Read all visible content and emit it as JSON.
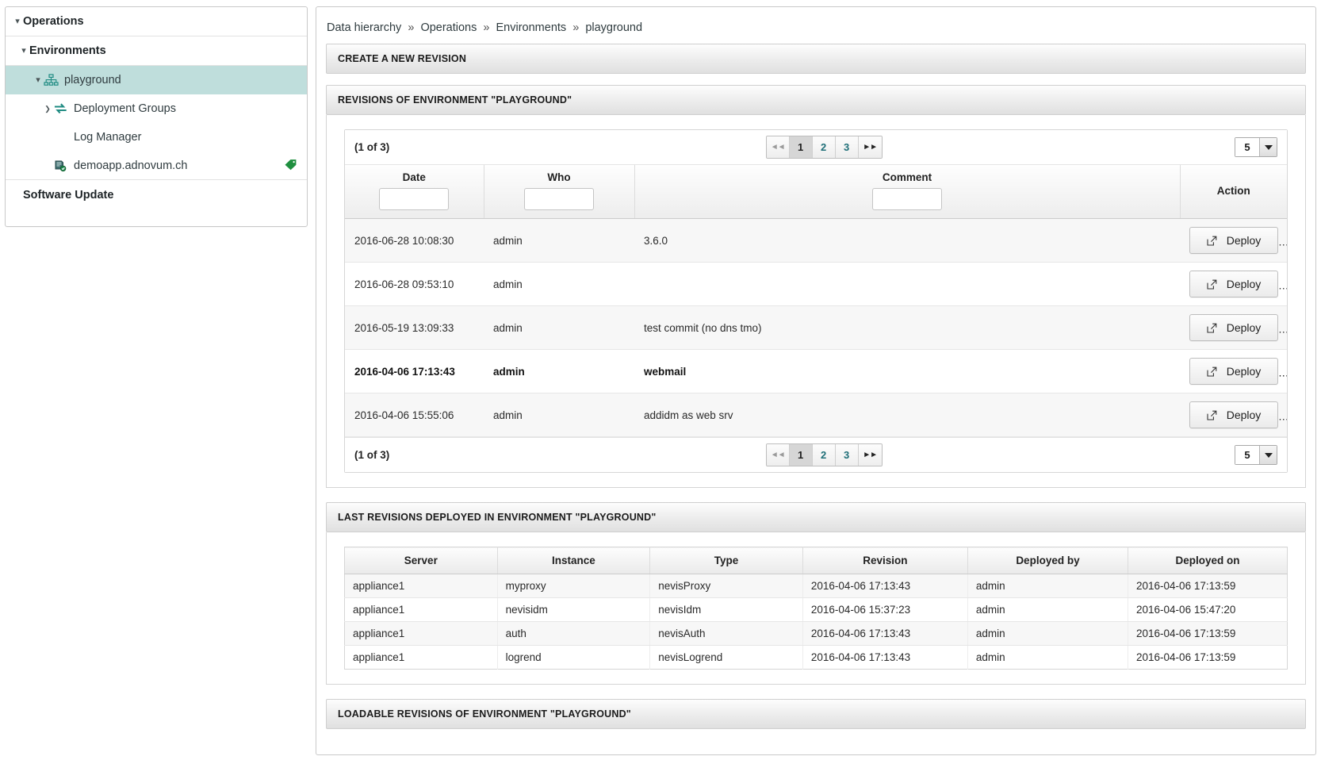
{
  "sidebar": {
    "items": [
      {
        "label": "Operations",
        "caret": "down",
        "icon": null,
        "level": 0,
        "bold": true,
        "selected": false
      },
      {
        "label": "Environments",
        "caret": "down",
        "icon": null,
        "level": 1,
        "bold": true,
        "selected": false
      },
      {
        "label": "playground",
        "caret": "down",
        "icon": "sitemap-icon",
        "level": 2,
        "bold": false,
        "selected": true
      },
      {
        "label": "Deployment Groups",
        "caret": "right",
        "icon": "sync-icon",
        "level": 3,
        "bold": false,
        "selected": false
      },
      {
        "label": "Log Manager",
        "caret": "empty",
        "icon": null,
        "level": 3,
        "bold": false,
        "selected": false
      },
      {
        "label": "demoapp.adnovum.ch",
        "caret": "empty",
        "icon": "server-icon",
        "level": 3,
        "bold": false,
        "selected": false,
        "trailing_icon": "tag-icon"
      },
      {
        "label": "Software Update",
        "caret": "empty",
        "icon": null,
        "level": 0,
        "bold": true,
        "selected": false
      }
    ]
  },
  "breadcrumb": {
    "items": [
      "Data hierarchy",
      "Operations",
      "Environments",
      "playground"
    ],
    "separator": "»"
  },
  "panels": {
    "create_revision_title": "CREATE A NEW REVISION",
    "revisions_title": "REVISIONS OF ENVIRONMENT \"PLAYGROUND\"",
    "last_deployed_title": "LAST REVISIONS DEPLOYED IN ENVIRONMENT \"PLAYGROUND\"",
    "loadable_title": "LOADABLE REVISIONS OF ENVIRONMENT \"PLAYGROUND\""
  },
  "revisions_table": {
    "pager": {
      "count_label": "(1 of 3)",
      "first_label": "◄◄",
      "last_label": "►►",
      "pages": [
        "1",
        "2",
        "3"
      ],
      "active_page": "1",
      "rows_per_page": "5"
    },
    "columns": [
      "Date",
      "Who",
      "Comment",
      "Action"
    ],
    "filters": {
      "date": "",
      "who": "",
      "comment": ""
    },
    "filter_placeholder": "",
    "action_label": "Deploy",
    "rows": [
      {
        "date": "2016-06-28 10:08:30",
        "who": "admin",
        "comment": "3.6.0",
        "bold": false
      },
      {
        "date": "2016-06-28 09:53:10",
        "who": "admin",
        "comment": "",
        "bold": false
      },
      {
        "date": "2016-05-19 13:09:33",
        "who": "admin",
        "comment": "test commit (no dns tmo)",
        "bold": false
      },
      {
        "date": "2016-04-06 17:13:43",
        "who": "admin",
        "comment": "webmail",
        "bold": true
      },
      {
        "date": "2016-04-06 15:55:06",
        "who": "admin",
        "comment": "addidm as web srv",
        "bold": false
      }
    ]
  },
  "last_deployed_table": {
    "columns": [
      "Server",
      "Instance",
      "Type",
      "Revision",
      "Deployed by",
      "Deployed on"
    ],
    "rows": [
      {
        "server": "appliance1",
        "instance": "myproxy",
        "type": "nevisProxy",
        "revision": "2016-04-06 17:13:43",
        "deployed_by": "admin",
        "deployed_on": "2016-04-06 17:13:59"
      },
      {
        "server": "appliance1",
        "instance": "nevisidm",
        "type": "nevisIdm",
        "revision": "2016-04-06 15:37:23",
        "deployed_by": "admin",
        "deployed_on": "2016-04-06 15:47:20"
      },
      {
        "server": "appliance1",
        "instance": "auth",
        "type": "nevisAuth",
        "revision": "2016-04-06 17:13:43",
        "deployed_by": "admin",
        "deployed_on": "2016-04-06 17:13:59"
      },
      {
        "server": "appliance1",
        "instance": "logrend",
        "type": "nevisLogrend",
        "revision": "2016-04-06 17:13:43",
        "deployed_by": "admin",
        "deployed_on": "2016-04-06 17:13:59"
      }
    ]
  },
  "colors": {
    "selected_row": "#bfdedc",
    "teal_icon": "#1f8b82",
    "link": "#1f6f78",
    "tag_green": "#1f8f3f"
  }
}
